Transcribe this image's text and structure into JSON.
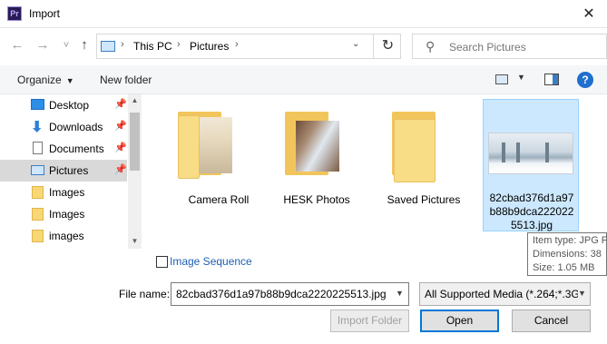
{
  "window": {
    "title": "Import",
    "app_icon_text": "Pr"
  },
  "nav": {
    "back": "←",
    "forward": "→",
    "recent": "˅",
    "up": "↑"
  },
  "address": {
    "crumbs": [
      "This PC",
      "Pictures"
    ],
    "separator": "›",
    "refresh": "↻",
    "dropdown": "⌄"
  },
  "search": {
    "placeholder": "Search Pictures"
  },
  "toolbar": {
    "organize": "Organize",
    "new_folder": "New folder",
    "help": "?"
  },
  "sidebar": {
    "items": [
      {
        "label": "Desktop",
        "icon": "desktop-icon",
        "pinned": true
      },
      {
        "label": "Downloads",
        "icon": "download-icon",
        "pinned": true
      },
      {
        "label": "Documents",
        "icon": "document-icon",
        "pinned": true
      },
      {
        "label": "Pictures",
        "icon": "pictures-icon",
        "pinned": true,
        "selected": true
      },
      {
        "label": "Images",
        "icon": "folder-icon",
        "pinned": false
      },
      {
        "label": "Images",
        "icon": "folder-icon",
        "pinned": false
      },
      {
        "label": "images",
        "icon": "folder-icon",
        "pinned": false
      }
    ],
    "pin_glyph": "📌"
  },
  "files": [
    {
      "name": "Camera Roll",
      "type": "folder"
    },
    {
      "name": "HESK Photos",
      "type": "folder"
    },
    {
      "name": "Saved Pictures",
      "type": "folder"
    },
    {
      "name_lines": [
        "82cbad376d1a97",
        "b88b9dca222022",
        "5513.jpg"
      ],
      "type": "image",
      "selected": true
    }
  ],
  "tooltip": {
    "type": "Item type: JPG F",
    "dimensions": "Dimensions: 38",
    "size": "Size: 1.05 MB"
  },
  "image_sequence": {
    "label": "Image Sequence",
    "checked": false
  },
  "filename": {
    "label": "File name:",
    "value": "82cbad376d1a97b88b9dca2220225513.jpg"
  },
  "filetype": {
    "value": "All Supported Media (*.264;*.3G"
  },
  "buttons": {
    "import_folder": "Import Folder",
    "open": "Open",
    "cancel": "Cancel"
  },
  "colors": {
    "accent": "#0078d7",
    "selection": "#cce8ff",
    "folder": "#f9dc86"
  }
}
